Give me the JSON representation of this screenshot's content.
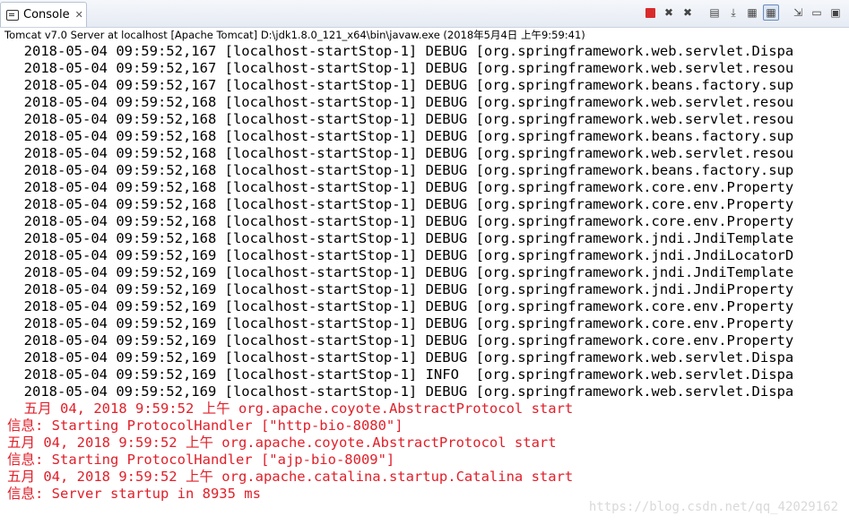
{
  "tab": {
    "label": "Console",
    "close": "✕"
  },
  "window": {
    "title": "Tomcat v7.0 Server at localhost [Apache Tomcat] D:\\jdk1.8.0_121_x64\\bin\\javaw.exe (2018年5月4日 上午9:59:41)"
  },
  "toolbar": {
    "items": [
      {
        "name": "terminate-icon",
        "glyph": ""
      },
      {
        "name": "remove-launch-icon",
        "glyph": "✖"
      },
      {
        "name": "remove-all-icon",
        "glyph": "✖"
      },
      {
        "name": "clear-console-icon",
        "glyph": "▤"
      },
      {
        "name": "scroll-lock-icon",
        "glyph": "⤓"
      },
      {
        "name": "show-stdout-icon",
        "glyph": "▦"
      },
      {
        "name": "show-stderr-icon",
        "glyph": "▦"
      },
      {
        "name": "pin-console-icon",
        "glyph": "⇲"
      },
      {
        "name": "display-console-icon",
        "glyph": "▭"
      },
      {
        "name": "open-console-icon",
        "glyph": "▣"
      }
    ]
  },
  "log_lines": [
    {
      "type": "debug",
      "text": "  2018-05-04 09:59:52,167 [localhost-startStop-1] DEBUG [org.springframework.web.servlet.Dispa"
    },
    {
      "type": "debug",
      "text": "  2018-05-04 09:59:52,167 [localhost-startStop-1] DEBUG [org.springframework.web.servlet.resou"
    },
    {
      "type": "debug",
      "text": "  2018-05-04 09:59:52,167 [localhost-startStop-1] DEBUG [org.springframework.beans.factory.sup"
    },
    {
      "type": "debug",
      "text": "  2018-05-04 09:59:52,168 [localhost-startStop-1] DEBUG [org.springframework.web.servlet.resou"
    },
    {
      "type": "debug",
      "text": "  2018-05-04 09:59:52,168 [localhost-startStop-1] DEBUG [org.springframework.web.servlet.resou"
    },
    {
      "type": "debug",
      "text": "  2018-05-04 09:59:52,168 [localhost-startStop-1] DEBUG [org.springframework.beans.factory.sup"
    },
    {
      "type": "debug",
      "text": "  2018-05-04 09:59:52,168 [localhost-startStop-1] DEBUG [org.springframework.web.servlet.resou"
    },
    {
      "type": "debug",
      "text": "  2018-05-04 09:59:52,168 [localhost-startStop-1] DEBUG [org.springframework.beans.factory.sup"
    },
    {
      "type": "debug",
      "text": "  2018-05-04 09:59:52,168 [localhost-startStop-1] DEBUG [org.springframework.core.env.Property"
    },
    {
      "type": "debug",
      "text": "  2018-05-04 09:59:52,168 [localhost-startStop-1] DEBUG [org.springframework.core.env.Property"
    },
    {
      "type": "debug",
      "text": "  2018-05-04 09:59:52,168 [localhost-startStop-1] DEBUG [org.springframework.core.env.Property"
    },
    {
      "type": "debug",
      "text": "  2018-05-04 09:59:52,168 [localhost-startStop-1] DEBUG [org.springframework.jndi.JndiTemplate"
    },
    {
      "type": "debug",
      "text": "  2018-05-04 09:59:52,169 [localhost-startStop-1] DEBUG [org.springframework.jndi.JndiLocatorD"
    },
    {
      "type": "debug",
      "text": "  2018-05-04 09:59:52,169 [localhost-startStop-1] DEBUG [org.springframework.jndi.JndiTemplate"
    },
    {
      "type": "debug",
      "text": "  2018-05-04 09:59:52,169 [localhost-startStop-1] DEBUG [org.springframework.jndi.JndiProperty"
    },
    {
      "type": "debug",
      "text": "  2018-05-04 09:59:52,169 [localhost-startStop-1] DEBUG [org.springframework.core.env.Property"
    },
    {
      "type": "debug",
      "text": "  2018-05-04 09:59:52,169 [localhost-startStop-1] DEBUG [org.springframework.core.env.Property"
    },
    {
      "type": "debug",
      "text": "  2018-05-04 09:59:52,169 [localhost-startStop-1] DEBUG [org.springframework.core.env.Property"
    },
    {
      "type": "debug",
      "text": "  2018-05-04 09:59:52,169 [localhost-startStop-1] DEBUG [org.springframework.web.servlet.Dispa"
    },
    {
      "type": "debug",
      "text": "  2018-05-04 09:59:52,169 [localhost-startStop-1] INFO  [org.springframework.web.servlet.Dispa"
    },
    {
      "type": "debug",
      "text": "  2018-05-04 09:59:52,169 [localhost-startStop-1] DEBUG [org.springframework.web.servlet.Dispa"
    },
    {
      "type": "err",
      "text": "  五月 04, 2018 9:59:52 上午 org.apache.coyote.AbstractProtocol start"
    },
    {
      "type": "err",
      "text": "信息: Starting ProtocolHandler [\"http-bio-8080\"]"
    },
    {
      "type": "err",
      "text": "五月 04, 2018 9:59:52 上午 org.apache.coyote.AbstractProtocol start"
    },
    {
      "type": "err",
      "text": "信息: Starting ProtocolHandler [\"ajp-bio-8009\"]"
    },
    {
      "type": "err",
      "text": "五月 04, 2018 9:59:52 上午 org.apache.catalina.startup.Catalina start"
    },
    {
      "type": "err",
      "text": "信息: Server startup in 8935 ms"
    }
  ],
  "watermark": "https://blog.csdn.net/qq_42029162",
  "colors": {
    "stderr": "#e0202a",
    "stdout": "#000000"
  }
}
